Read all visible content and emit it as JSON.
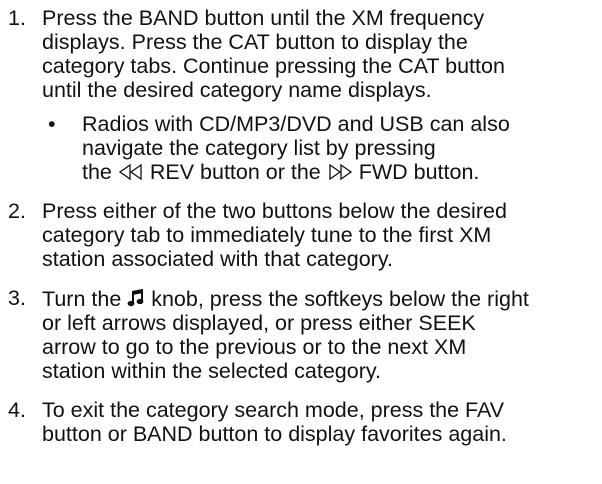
{
  "steps": [
    {
      "number": "1.",
      "lines": [
        "Press the BAND button until the XM frequency",
        "displays. Press the CAT button to display the",
        "category tabs. Continue pressing the CAT button",
        "until the desired category name displays."
      ],
      "bullet": {
        "marker": "•",
        "lines": [
          "Radios with CD/MP3/DVD and USB can also",
          "navigate the category list by pressing"
        ],
        "last_line": {
          "before": "the ",
          "rev": " REV button or the ",
          "fwd": " FWD button."
        },
        "icons": [
          "rewind-icon",
          "fast-forward-icon"
        ]
      }
    },
    {
      "number": "2.",
      "lines": [
        "Press either of the two buttons below the desired",
        "category tab to immediately tune to the first XM",
        "station associated with that category."
      ]
    },
    {
      "number": "3.",
      "first_line": {
        "before": "Turn the ",
        "after": " knob, press the softkeys below the right"
      },
      "icon": "music-note-icon",
      "lines": [
        "or left arrows displayed, or press either SEEK",
        "arrow to go to the previous or to the next XM",
        "station within the selected category."
      ]
    },
    {
      "number": "4.",
      "lines": [
        "To exit the category search mode, press the FAV",
        "button or BAND button to display favorites again."
      ]
    }
  ]
}
